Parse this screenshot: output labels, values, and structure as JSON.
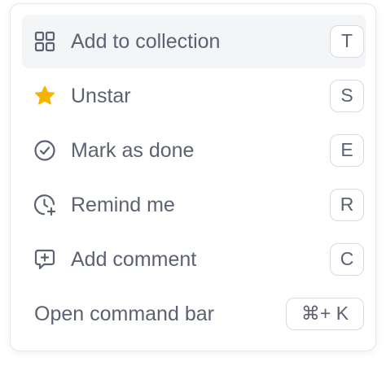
{
  "menu": {
    "items": [
      {
        "label": "Add to collection",
        "shortcut": "T",
        "icon": "grid-icon",
        "active": true
      },
      {
        "label": "Unstar",
        "shortcut": "S",
        "icon": "star-icon"
      },
      {
        "label": "Mark as done",
        "shortcut": "E",
        "icon": "check-circle-icon"
      },
      {
        "label": "Remind me",
        "shortcut": "R",
        "icon": "clock-plus-icon"
      },
      {
        "label": "Add comment",
        "shortcut": "C",
        "icon": "comment-plus-icon"
      },
      {
        "label": "Open command bar",
        "shortcut": "⌘+ K"
      }
    ]
  },
  "colors": {
    "text": "#5b6271",
    "star": "#f5b400",
    "hover_bg": "#f4f5f7",
    "border": "#d7dae0"
  }
}
